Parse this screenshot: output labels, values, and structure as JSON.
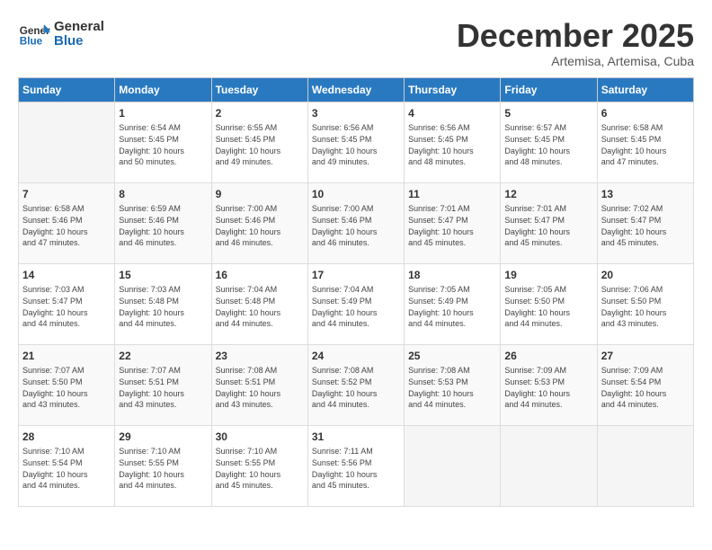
{
  "logo": {
    "general": "General",
    "blue": "Blue"
  },
  "title": "December 2025",
  "subtitle": "Artemisa, Artemisa, Cuba",
  "header": {
    "days": [
      "Sunday",
      "Monday",
      "Tuesday",
      "Wednesday",
      "Thursday",
      "Friday",
      "Saturday"
    ]
  },
  "weeks": [
    [
      {
        "day": "",
        "info": ""
      },
      {
        "day": "1",
        "info": "Sunrise: 6:54 AM\nSunset: 5:45 PM\nDaylight: 10 hours\nand 50 minutes."
      },
      {
        "day": "2",
        "info": "Sunrise: 6:55 AM\nSunset: 5:45 PM\nDaylight: 10 hours\nand 49 minutes."
      },
      {
        "day": "3",
        "info": "Sunrise: 6:56 AM\nSunset: 5:45 PM\nDaylight: 10 hours\nand 49 minutes."
      },
      {
        "day": "4",
        "info": "Sunrise: 6:56 AM\nSunset: 5:45 PM\nDaylight: 10 hours\nand 48 minutes."
      },
      {
        "day": "5",
        "info": "Sunrise: 6:57 AM\nSunset: 5:45 PM\nDaylight: 10 hours\nand 48 minutes."
      },
      {
        "day": "6",
        "info": "Sunrise: 6:58 AM\nSunset: 5:45 PM\nDaylight: 10 hours\nand 47 minutes."
      }
    ],
    [
      {
        "day": "7",
        "info": "Sunrise: 6:58 AM\nSunset: 5:46 PM\nDaylight: 10 hours\nand 47 minutes."
      },
      {
        "day": "8",
        "info": "Sunrise: 6:59 AM\nSunset: 5:46 PM\nDaylight: 10 hours\nand 46 minutes."
      },
      {
        "day": "9",
        "info": "Sunrise: 7:00 AM\nSunset: 5:46 PM\nDaylight: 10 hours\nand 46 minutes."
      },
      {
        "day": "10",
        "info": "Sunrise: 7:00 AM\nSunset: 5:46 PM\nDaylight: 10 hours\nand 46 minutes."
      },
      {
        "day": "11",
        "info": "Sunrise: 7:01 AM\nSunset: 5:47 PM\nDaylight: 10 hours\nand 45 minutes."
      },
      {
        "day": "12",
        "info": "Sunrise: 7:01 AM\nSunset: 5:47 PM\nDaylight: 10 hours\nand 45 minutes."
      },
      {
        "day": "13",
        "info": "Sunrise: 7:02 AM\nSunset: 5:47 PM\nDaylight: 10 hours\nand 45 minutes."
      }
    ],
    [
      {
        "day": "14",
        "info": "Sunrise: 7:03 AM\nSunset: 5:47 PM\nDaylight: 10 hours\nand 44 minutes."
      },
      {
        "day": "15",
        "info": "Sunrise: 7:03 AM\nSunset: 5:48 PM\nDaylight: 10 hours\nand 44 minutes."
      },
      {
        "day": "16",
        "info": "Sunrise: 7:04 AM\nSunset: 5:48 PM\nDaylight: 10 hours\nand 44 minutes."
      },
      {
        "day": "17",
        "info": "Sunrise: 7:04 AM\nSunset: 5:49 PM\nDaylight: 10 hours\nand 44 minutes."
      },
      {
        "day": "18",
        "info": "Sunrise: 7:05 AM\nSunset: 5:49 PM\nDaylight: 10 hours\nand 44 minutes."
      },
      {
        "day": "19",
        "info": "Sunrise: 7:05 AM\nSunset: 5:50 PM\nDaylight: 10 hours\nand 44 minutes."
      },
      {
        "day": "20",
        "info": "Sunrise: 7:06 AM\nSunset: 5:50 PM\nDaylight: 10 hours\nand 43 minutes."
      }
    ],
    [
      {
        "day": "21",
        "info": "Sunrise: 7:07 AM\nSunset: 5:50 PM\nDaylight: 10 hours\nand 43 minutes."
      },
      {
        "day": "22",
        "info": "Sunrise: 7:07 AM\nSunset: 5:51 PM\nDaylight: 10 hours\nand 43 minutes."
      },
      {
        "day": "23",
        "info": "Sunrise: 7:08 AM\nSunset: 5:51 PM\nDaylight: 10 hours\nand 43 minutes."
      },
      {
        "day": "24",
        "info": "Sunrise: 7:08 AM\nSunset: 5:52 PM\nDaylight: 10 hours\nand 44 minutes."
      },
      {
        "day": "25",
        "info": "Sunrise: 7:08 AM\nSunset: 5:53 PM\nDaylight: 10 hours\nand 44 minutes."
      },
      {
        "day": "26",
        "info": "Sunrise: 7:09 AM\nSunset: 5:53 PM\nDaylight: 10 hours\nand 44 minutes."
      },
      {
        "day": "27",
        "info": "Sunrise: 7:09 AM\nSunset: 5:54 PM\nDaylight: 10 hours\nand 44 minutes."
      }
    ],
    [
      {
        "day": "28",
        "info": "Sunrise: 7:10 AM\nSunset: 5:54 PM\nDaylight: 10 hours\nand 44 minutes."
      },
      {
        "day": "29",
        "info": "Sunrise: 7:10 AM\nSunset: 5:55 PM\nDaylight: 10 hours\nand 44 minutes."
      },
      {
        "day": "30",
        "info": "Sunrise: 7:10 AM\nSunset: 5:55 PM\nDaylight: 10 hours\nand 45 minutes."
      },
      {
        "day": "31",
        "info": "Sunrise: 7:11 AM\nSunset: 5:56 PM\nDaylight: 10 hours\nand 45 minutes."
      },
      {
        "day": "",
        "info": ""
      },
      {
        "day": "",
        "info": ""
      },
      {
        "day": "",
        "info": ""
      }
    ]
  ]
}
